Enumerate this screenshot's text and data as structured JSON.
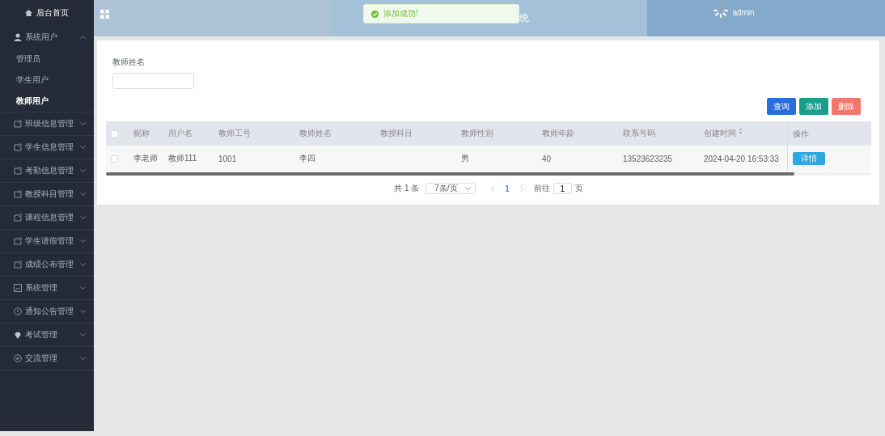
{
  "sidebar": {
    "home": "后台首页",
    "groups": [
      {
        "label": "系统用户",
        "kind": "user",
        "expanded": true,
        "children": [
          {
            "label": "管理员",
            "selected": false
          },
          {
            "label": "学生用户",
            "selected": false
          },
          {
            "label": "教师用户",
            "selected": true
          }
        ]
      },
      {
        "label": "班级信息管理",
        "kind": "doc",
        "expanded": false
      },
      {
        "label": "学生信息管理",
        "kind": "doc",
        "expanded": false
      },
      {
        "label": "考勤信息管理",
        "kind": "doc",
        "expanded": false
      },
      {
        "label": "教授科目管理",
        "kind": "doc",
        "expanded": false
      },
      {
        "label": "课程信息管理",
        "kind": "doc",
        "expanded": false
      },
      {
        "label": "学生请假管理",
        "kind": "doc",
        "expanded": false
      },
      {
        "label": "成绩公布管理",
        "kind": "doc",
        "expanded": false
      },
      {
        "label": "系统管理",
        "kind": "image",
        "expanded": false
      },
      {
        "label": "通知公告管理",
        "kind": "info",
        "expanded": false
      },
      {
        "label": "考试管理",
        "kind": "pin",
        "expanded": false
      },
      {
        "label": "交流管理",
        "kind": "chat",
        "expanded": false
      }
    ]
  },
  "header": {
    "title": "统",
    "user": "admin"
  },
  "toast": {
    "message": "添加成功!"
  },
  "search": {
    "label": "教师姓名"
  },
  "buttons": [
    {
      "label": "查询",
      "kind": "primary"
    },
    {
      "label": "添加",
      "kind": "success"
    },
    {
      "label": "删除",
      "kind": "danger"
    }
  ],
  "table": {
    "select_all_checked": false,
    "columns": [
      {
        "label": "昵称"
      },
      {
        "label": "用户名"
      },
      {
        "label": "教师工号"
      },
      {
        "label": "教师姓名"
      },
      {
        "label": "教授科目"
      },
      {
        "label": "教师性别"
      },
      {
        "label": "教师年龄"
      },
      {
        "label": "联系号码"
      },
      {
        "label": "创建时间",
        "sortable": true
      },
      {
        "label": "操作"
      }
    ],
    "rows": [
      {
        "checked": false,
        "cells": [
          "李老师",
          "教师111",
          "1001",
          "李四",
          "",
          "男",
          "40",
          "13523623235",
          "2024-04-20 16:53:33"
        ],
        "action": "详情"
      }
    ]
  },
  "pagination": {
    "total": "共 1 条",
    "page_size": "7条/页",
    "pages": [
      {
        "label": "1",
        "selected": true
      }
    ],
    "goto_label": "前往",
    "goto_value": "1",
    "goto_suffix": "页"
  }
}
